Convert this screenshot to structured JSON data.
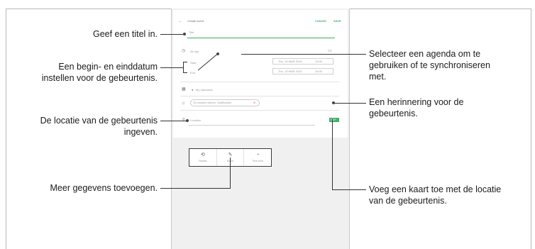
{
  "screen": {
    "header": {
      "back_icon": "arrow-back-icon",
      "title": "Create event",
      "cancel": "CANCEL",
      "save": "SAVE"
    },
    "form": {
      "title_placeholder": "Title",
      "all_day": "All day",
      "start_label": "Start",
      "start_date": "Thu, 15 MAR 2015",
      "start_time": "13:00",
      "end_label": "End",
      "end_date": "Thu, 15 MAR 2015",
      "end_time": "14:00",
      "calendar": "My calendars",
      "reminder": "15 minutes before, Notification",
      "location_placeholder": "Location",
      "map_button": "MAP"
    },
    "toolbar": [
      {
        "icon": "repeat-icon",
        "label": "Repeat"
      },
      {
        "icon": "notes-icon",
        "label": "Notes"
      },
      {
        "icon": "time-zone-icon",
        "label": "Time zone"
      }
    ]
  },
  "callouts": {
    "title": "Geef een titel in.",
    "dates_line1": "Een begin- en einddatum",
    "dates_line2": "instellen voor de gebeurtenis.",
    "location_line1": "De locatie van de gebeurtenis",
    "location_line2": "ingeven.",
    "details": "Meer gegevens toevoegen.",
    "calendar_line1": "Selecteer een agenda om te",
    "calendar_line2": "gebruiken of te synchroniseren",
    "calendar_line3": "met.",
    "reminder_line1": "Een herinnering voor de",
    "reminder_line2": "gebeurtenis.",
    "map_line1": "Voeg een kaart toe met de locatie",
    "map_line2": "van de gebeurtenis."
  },
  "colors": {
    "accent": "#3cae5e",
    "leader": "#333333",
    "screen_bg": "#f0f0f0"
  }
}
